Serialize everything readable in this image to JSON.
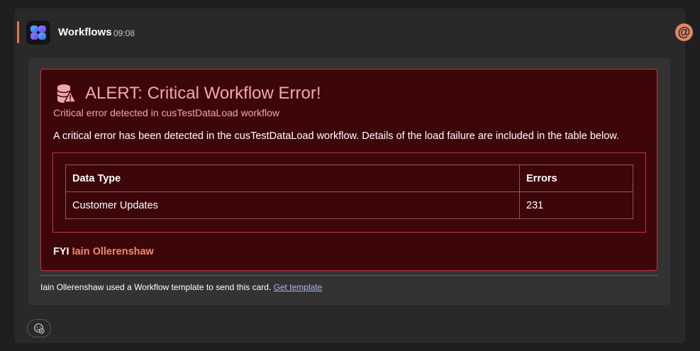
{
  "message": {
    "sender": "Workflows",
    "timestamp": "09:08",
    "accent_color": "#e97548"
  },
  "alert": {
    "title": "ALERT: Critical Workflow Error!",
    "subtitle": "Critical error detected in cusTestDataLoad workflow",
    "body": "A critical error has been detected in the cusTestDataLoad workflow. Details of the load failure are included in the table below.",
    "icon": "database-warning-icon",
    "title_color": "#f1a7b0",
    "border_color": "#c4314b",
    "background_color": "#3d0609",
    "table": {
      "headers": [
        "Data Type",
        "Errors"
      ],
      "rows": [
        [
          "Customer Updates",
          "231"
        ]
      ]
    },
    "fyi_label": "FYI",
    "fyi_mention": "Iain Ollerenshaw"
  },
  "footer": {
    "text": "Iain Ollerenshaw used a Workflow template to send this card.",
    "link": "Get template"
  },
  "mention_badge": "@"
}
